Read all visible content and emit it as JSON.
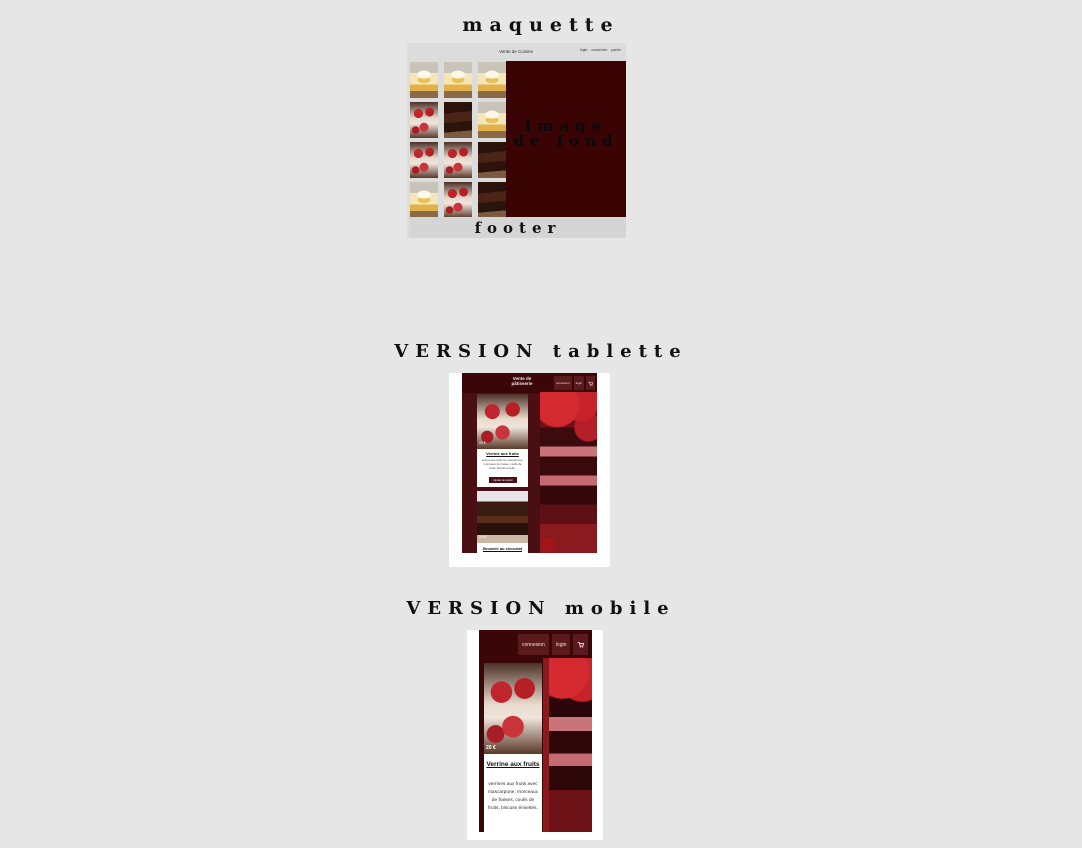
{
  "sections": {
    "maquette_title": "maquette",
    "tablet_title": "VERSION tablette",
    "mobile_title": "VERSION mobile"
  },
  "maquette": {
    "header_title": "Vente de Cuisine",
    "nav": [
      "login",
      "connexion",
      "panier"
    ],
    "background_label": "Image de fond",
    "footer_label": "footer",
    "thumbnails": [
      "verrine",
      "verrine",
      "verrine",
      "strawberry",
      "brownie",
      "verrine",
      "strawberry",
      "strawberry",
      "brownie",
      "verrine",
      "strawberry",
      "brownie"
    ]
  },
  "tablet": {
    "logo": "Vente de pâtisserie",
    "nav": [
      "connexion",
      "login",
      "cart-icon"
    ],
    "cards": [
      {
        "price": "20 €",
        "title": "Verrine aux fruits",
        "description": "verrine aux fruits au mascarpone, morceaux de fraises, coulis de fruits, biscuit émietté.",
        "button": "Ajouter au panier"
      },
      {
        "price": "20 €",
        "title": "Brownie au chocolat"
      }
    ]
  },
  "mobile": {
    "nav": [
      "connexion",
      "login",
      "cart-icon"
    ],
    "card": {
      "price": "20 €",
      "title": "Verrine aux fruits",
      "description": "verrines aux fruits avec mascarpone, morceaux de fraises, coulis de fruits, biscuits émiettés."
    }
  },
  "colors": {
    "page_bg": "#e6e6e6",
    "brand_dark": "#3a0608",
    "brand": "#4a0f12"
  }
}
